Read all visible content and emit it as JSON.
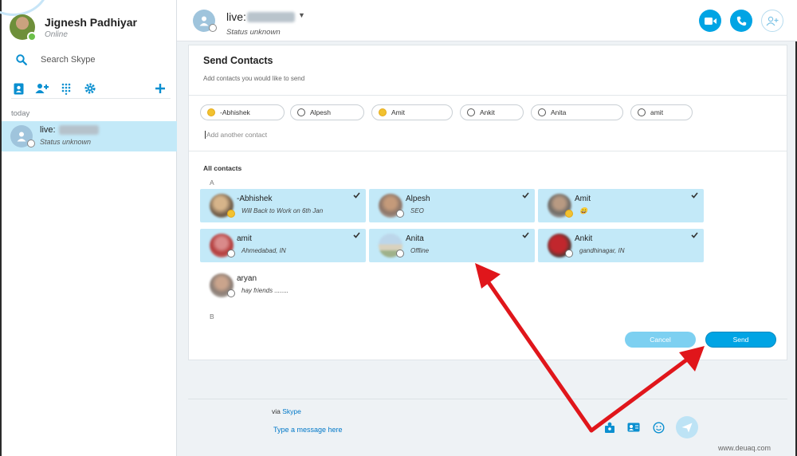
{
  "user": {
    "name": "Jignesh Padhiyar",
    "mood": "Online"
  },
  "search": {
    "placeholder": "Search Skype"
  },
  "sidebar": {
    "section": "today"
  },
  "recent": {
    "name": "live:",
    "status": "Status unknown"
  },
  "conversation": {
    "name": "live:",
    "status": "Status unknown"
  },
  "send_contacts": {
    "title": "Send Contacts",
    "subtitle": "Add contacts you would like to send",
    "selected": [
      {
        "name": "-Abhishek",
        "status": "away"
      },
      {
        "name": "Alpesh",
        "status": "offline"
      },
      {
        "name": "Amit",
        "status": "away"
      },
      {
        "name": "Ankit",
        "status": "offline"
      },
      {
        "name": "Anita",
        "status": "offline"
      },
      {
        "name": "amit",
        "status": "offline"
      }
    ],
    "add_placeholder": "Add another contact",
    "all_contacts_label": "All contacts",
    "groups": [
      {
        "letter": "A",
        "contacts": [
          {
            "name": "-Abhishek",
            "subtitle": "Will Back to Work on 6th Jan",
            "selected": true,
            "status": "away"
          },
          {
            "name": "Alpesh",
            "subtitle": "SEO",
            "selected": true,
            "status": "offline"
          },
          {
            "name": "Amit",
            "subtitle": "😀",
            "selected": true,
            "status": "away"
          },
          {
            "name": "amit",
            "subtitle": "Ahmedabad, IN",
            "selected": true,
            "status": "offline"
          },
          {
            "name": "Anita",
            "subtitle": "Offline",
            "selected": true,
            "status": "offline"
          },
          {
            "name": "Ankit",
            "subtitle": "gandhinagar, IN",
            "selected": true,
            "status": "offline"
          },
          {
            "name": "aryan",
            "subtitle": "hay friends ........",
            "selected": false,
            "status": "offline"
          }
        ]
      },
      {
        "letter": "B",
        "contacts": []
      }
    ],
    "cancel_label": "Cancel",
    "send_label": "Send"
  },
  "compose": {
    "via_prefix": "via",
    "via_service": "Skype",
    "placeholder": "Type a message here"
  },
  "watermark": "www.deuaq.com",
  "colors": {
    "accent": "#00a4e4",
    "selected_bg": "#c3e9f8",
    "arrow": "#e0161b"
  },
  "icons": [
    "search-icon",
    "contacts-book-icon",
    "add-contact-icon",
    "dialpad-icon",
    "settings-icon",
    "plus-icon",
    "video-call-icon",
    "audio-call-icon",
    "add-people-icon",
    "checkmark-icon",
    "share-contact-icon",
    "contact-card-icon",
    "emoji-icon",
    "send-arrow-icon"
  ]
}
